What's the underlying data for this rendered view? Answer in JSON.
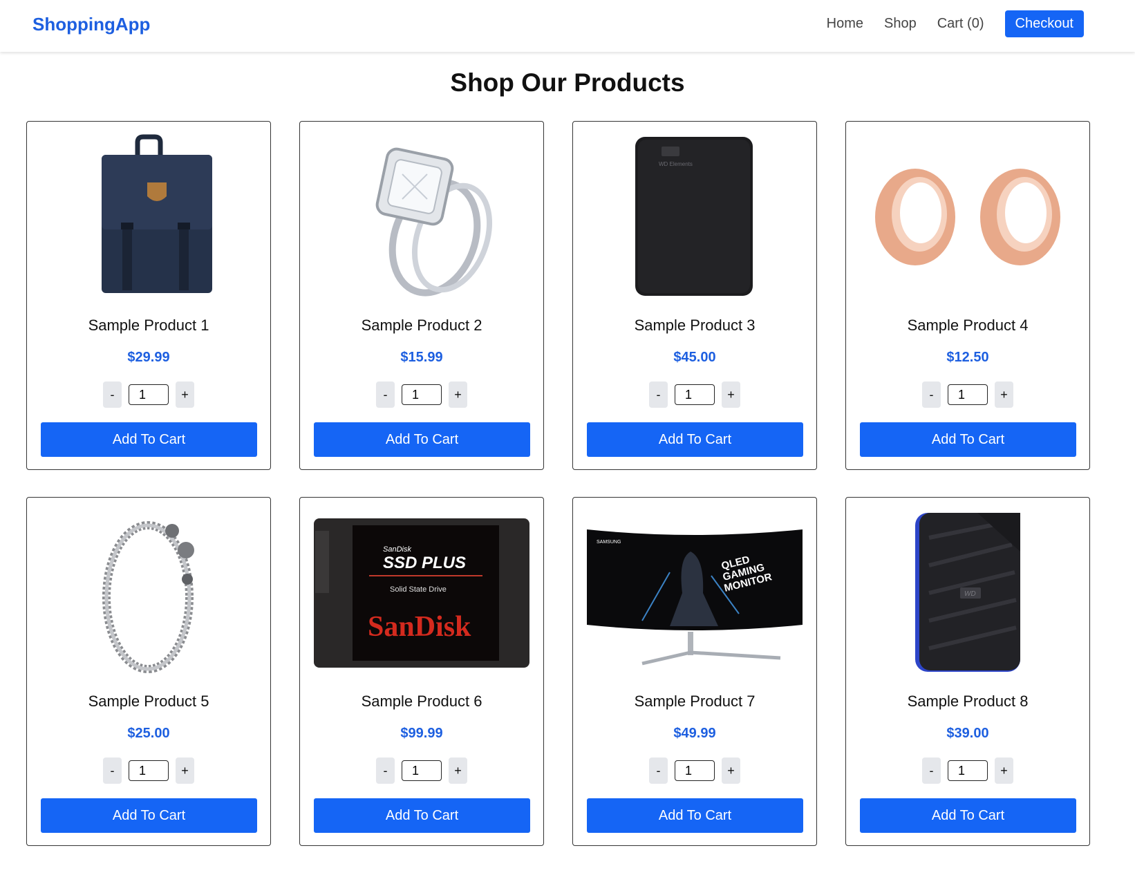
{
  "nav": {
    "brand": "ShoppingApp",
    "links": [
      "Home",
      "Shop",
      "Cart (0)"
    ],
    "checkout_label": "Checkout"
  },
  "page": {
    "title": "Shop Our Products"
  },
  "products": [
    {
      "name": "Sample Product 1",
      "price": "$29.99",
      "qty": "1",
      "image": "backpack"
    },
    {
      "name": "Sample Product 2",
      "price": "$15.99",
      "qty": "1",
      "image": "diamond-ring"
    },
    {
      "name": "Sample Product 3",
      "price": "$45.00",
      "qty": "1",
      "image": "external-hard-drive"
    },
    {
      "name": "Sample Product 4",
      "price": "$12.50",
      "qty": "1",
      "image": "rose-gold-plugs"
    },
    {
      "name": "Sample Product 5",
      "price": "$25.00",
      "qty": "1",
      "image": "dragon-bracelet"
    },
    {
      "name": "Sample Product 6",
      "price": "$99.99",
      "qty": "1",
      "image": "sandisk-ssd"
    },
    {
      "name": "Sample Product 7",
      "price": "$49.99",
      "qty": "1",
      "image": "curved-monitor"
    },
    {
      "name": "Sample Product 8",
      "price": "$39.00",
      "qty": "1",
      "image": "portable-drive"
    }
  ],
  "card_labels": {
    "minus": "-",
    "plus": "+",
    "add_to_cart": "Add To Cart"
  },
  "image_text": {
    "drive_logo": "WD Elements",
    "ssd_small": "SanDisk",
    "ssd_title": "SSD PLUS",
    "ssd_sub": "Solid State Drive",
    "ssd_brand": "SanDisk",
    "monitor_brand": "SAMSUNG",
    "monitor_text": [
      "QLED",
      "GAMING",
      "MONITOR"
    ],
    "wd_logo": "WD"
  },
  "colors": {
    "accent": "#1565f5",
    "brand": "#1d5fe0",
    "price": "#1d5fe0"
  }
}
